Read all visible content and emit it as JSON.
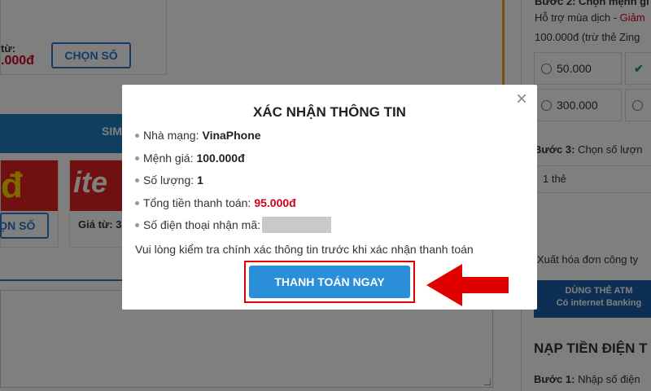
{
  "background": {
    "price_label": "từ:",
    "price_value": ".000đ",
    "choose_button": "CHỌN SỐ",
    "choose_button_2": "CHỌN SỐ",
    "sim_band_label": "SIM",
    "card_a_logo": "đ",
    "card_b_logo": "ite",
    "price_from_2": "Giá từ: 3",
    "step2_title": "Bước 2: Chọn mệnh gi",
    "support_prefix": "Hỗ trợ mùa dịch - ",
    "support_highlight": "Giảm",
    "support_line2": "100.000đ (trừ thẻ Zing",
    "denominations": [
      "50.000",
      "",
      "300.000",
      ""
    ],
    "step3_label": "Bước 3:",
    "step3_text": " Chọn số lượn",
    "qty_value": "1 thẻ",
    "invoice_text": "Xuất hóa đơn công ty",
    "atm_line1": "DÙNG THẺ ATM",
    "atm_line2": "Có internet Banking",
    "nap_title": "NẠP TIỀN ĐIỆN T",
    "step1_label": "Bước 1:",
    "step1_text": " Nhập số điện"
  },
  "modal": {
    "title": "XÁC NHẬN THÔNG TIN",
    "close_glyph": "×",
    "info": {
      "carrier_label": "Nhà mạng:",
      "carrier_value": "VinaPhone",
      "denomination_label": "Mệnh giá:",
      "denomination_value": "100.000đ",
      "quantity_label": "Số lượng:",
      "quantity_value": "1",
      "total_label": "Tổng tiền thanh toán:",
      "total_value": "95.000đ",
      "phone_label": "Số điện thoại nhận mã:"
    },
    "note": "Vui lòng kiểm tra chính xác thông tin trước khi xác nhận thanh toán",
    "pay_button": "THANH TOÁN NGAY"
  },
  "colors": {
    "accent_blue": "#2a8fd8",
    "highlight_red": "#e00000",
    "price_red": "#d0021b"
  }
}
